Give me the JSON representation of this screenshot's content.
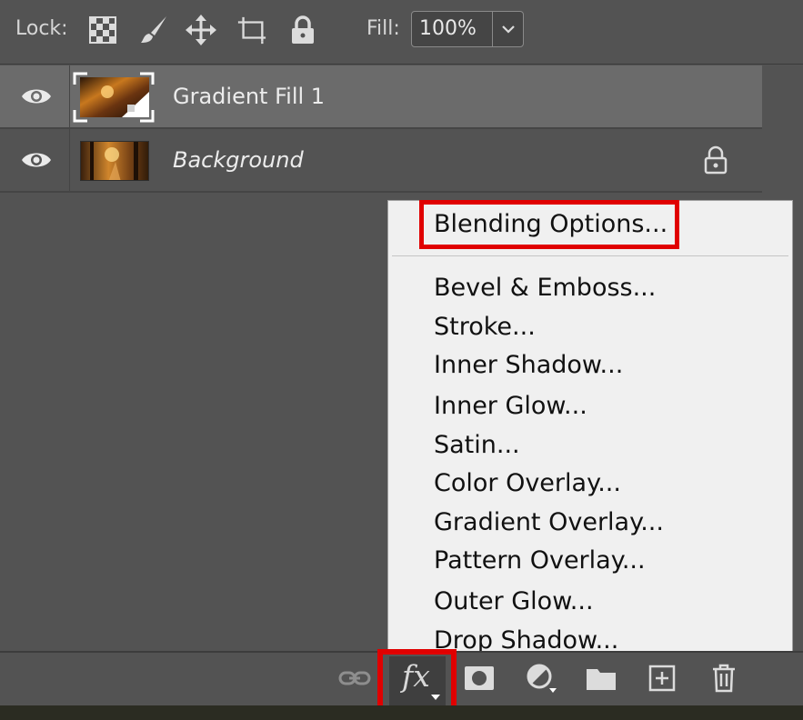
{
  "lock_bar": {
    "lock_label": "Lock:",
    "fill_label": "Fill:",
    "fill_value": "100%"
  },
  "layers": [
    {
      "name": "Gradient Fill 1",
      "selected": true,
      "visible": true,
      "locked": false
    },
    {
      "name": "Background",
      "selected": false,
      "visible": true,
      "locked": true
    }
  ],
  "menu": {
    "items": [
      "Blending Options...",
      "Bevel & Emboss...",
      "Stroke...",
      "Inner Shadow...",
      "Inner Glow...",
      "Satin...",
      "Color Overlay...",
      "Gradient Overlay...",
      "Pattern Overlay...",
      "Outer Glow...",
      "Drop Shadow..."
    ]
  },
  "toolbar": {
    "fx_label": "fx"
  },
  "colors": {
    "panel_bg": "#535353",
    "selected_layer": "#6b6b6b",
    "menu_bg": "#f0f0f0",
    "highlight": "#e00000"
  },
  "icons": [
    "lock-transparent-pixels-icon",
    "lock-image-pixels-icon",
    "lock-position-icon",
    "lock-artboard-icon",
    "lock-all-icon",
    "chevron-down-icon",
    "eye-icon",
    "padlock-icon",
    "link-icon",
    "fx-icon",
    "mask-icon",
    "adjustment-icon",
    "folder-icon",
    "new-layer-icon",
    "trash-icon"
  ]
}
